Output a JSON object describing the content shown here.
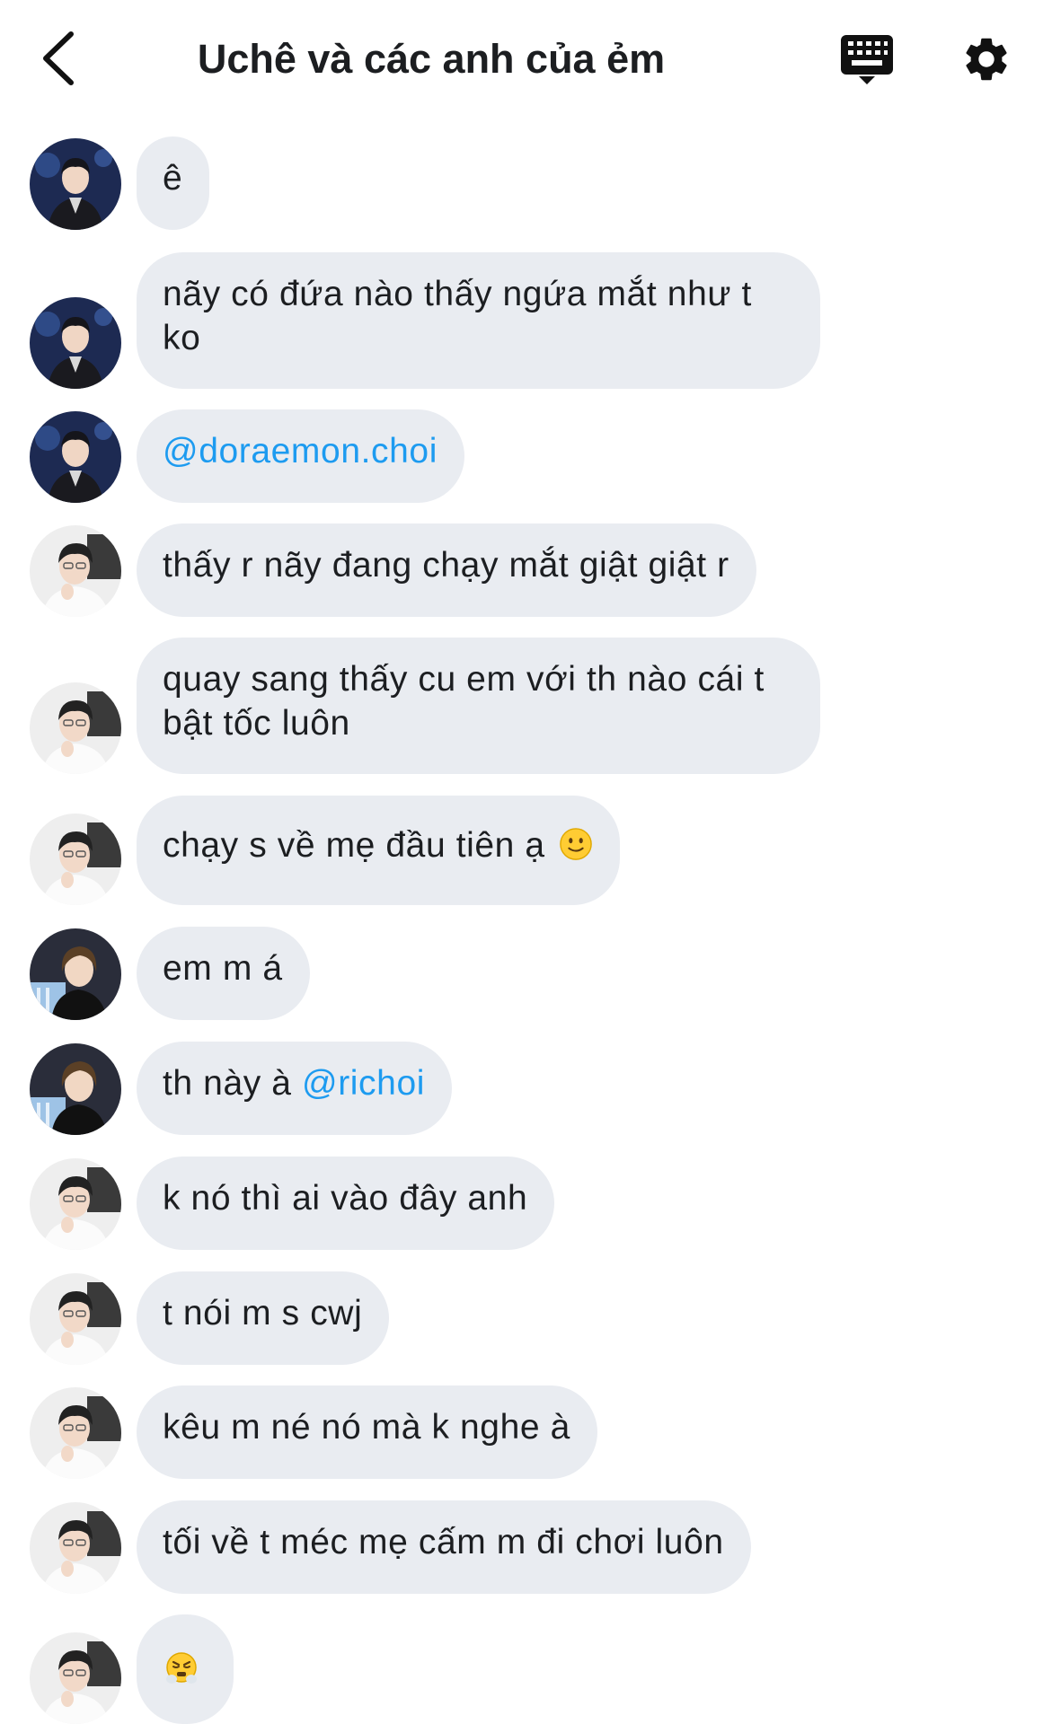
{
  "header": {
    "title": "Uchê và các anh của ẻm",
    "back_icon": "chevron-left-icon",
    "keyboard_icon": "keyboard-icon",
    "settings_icon": "gear-icon"
  },
  "messages": [
    {
      "text": "ê"
    },
    {
      "line1": "nãy có đứa nào thấy ngứa mắt như t",
      "line2": "ko"
    },
    {
      "mention": "@doraemon.choi"
    },
    {
      "text": "thấy r nãy đang chạy mắt giật giật r"
    },
    {
      "line1": "quay sang thấy cu em với th nào cái t",
      "line2": "bật tốc luôn"
    },
    {
      "text": "chạy s về mẹ đầu tiên ạ",
      "emoji": "slightly-smiling-face-emoji"
    },
    {
      "text": "em m á"
    },
    {
      "text": "th này à ",
      "mention": "@richoi"
    },
    {
      "text": "k nó thì ai vào đây anh"
    },
    {
      "text": "t nói m s cwj"
    },
    {
      "text": "kêu m né nó mà k nghe à"
    },
    {
      "text": "tối về t méc mẹ cấm m đi chơi luôn"
    },
    {
      "emoji": "face-with-steam-from-nose-emoji"
    }
  ],
  "colors": {
    "bubble": "#e9ecf1",
    "mention": "#1d9bf0",
    "text": "#1c1e21"
  }
}
